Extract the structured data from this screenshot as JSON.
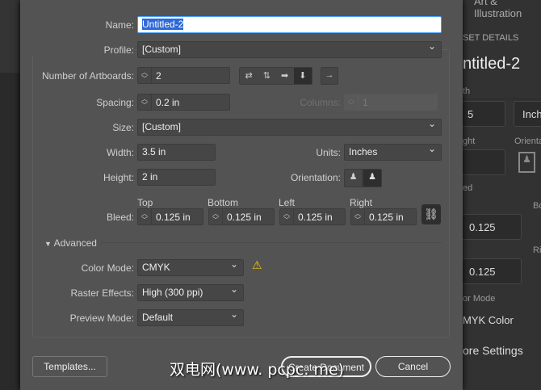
{
  "dialog": {
    "name_label": "Name:",
    "name_value": "Untitled-2",
    "profile_label": "Profile:",
    "profile_value": "[Custom]",
    "artboards_label": "Number of Artboards:",
    "artboards_value": "2",
    "spacing_label": "Spacing:",
    "spacing_value": "0.2 in",
    "columns_label": "Columns:",
    "columns_value": "1",
    "size_label": "Size:",
    "size_value": "[Custom]",
    "width_label": "Width:",
    "width_value": "3.5 in",
    "units_label": "Units:",
    "units_value": "Inches",
    "height_label": "Height:",
    "height_value": "2 in",
    "orientation_label": "Orientation:",
    "bleed_label": "Bleed:",
    "bleed": [
      {
        "label": "Top",
        "value": "0.125 in"
      },
      {
        "label": "Bottom",
        "value": "0.125 in"
      },
      {
        "label": "Left",
        "value": "0.125 in"
      },
      {
        "label": "Right",
        "value": "0.125 in"
      }
    ],
    "advanced_label": "Advanced",
    "color_mode_label": "Color Mode:",
    "color_mode_value": "CMYK",
    "raster_label": "Raster Effects:",
    "raster_value": "High (300 ppi)",
    "preview_label": "Preview Mode:",
    "preview_value": "Default",
    "templates_button": "Templates...",
    "create_button": "Create Document",
    "cancel_button": "Cancel"
  },
  "right_panel": {
    "top": "Art & Illustration",
    "section": "SET DETAILS",
    "name": "ntitled-2",
    "width_lbl": "th",
    "width_val": "5",
    "units": "Inch",
    "height_lbl": "ght",
    "orient_lbl": "Orienta",
    "bleed_lbl": "ed",
    "bottom_lbl": "Bo",
    "right_lbl": "Ri",
    "bleed_val1": "0.125",
    "bleed_val2": "0.125",
    "color_lbl": "or Mode",
    "color_val": "MYK Color",
    "more": "ore Settings"
  },
  "watermark": "双电网(www. pcpc. me)",
  "colors": {
    "dialog_bg": "#535353",
    "selection": "#2d6ad8",
    "focus": "#4aa0ff"
  }
}
